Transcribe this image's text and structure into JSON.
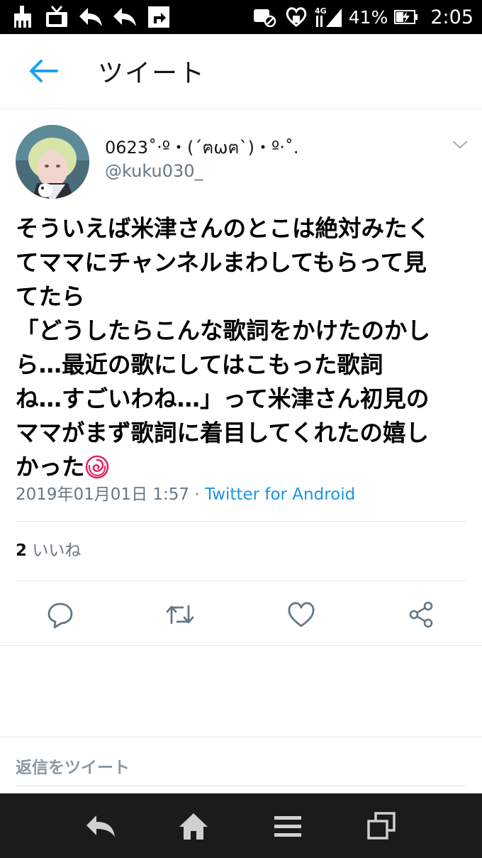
{
  "status_bar": {
    "battery": "41%",
    "time": "2:05",
    "network": "4G",
    "icons": [
      "broom-icon",
      "tv-icon",
      "reply-arrow-icon",
      "reply-arrow-icon",
      "share-box-icon",
      "no-sim-icon",
      "heart-shield-icon",
      "signal-icon",
      "battery-charging-icon"
    ]
  },
  "header": {
    "title": "ツイート",
    "back_icon": "back-arrow-icon",
    "accent_color": "#1da1f2"
  },
  "tweet": {
    "display_name": "0623˚‧º・(´ฅωฅ`)・º‧˚.",
    "screen_name": "@kuku030_",
    "text": "そういえば米津さんのとこは絶対みたく\nてママにチャンネルまわしてもらって見\nてたら\n「どうしたらこんな歌詞をかけたのかし\nら…最近の歌にしてはこもった歌詞\nね…すごいわね…」って米津さん初見の\nママがまず歌詞に着目してくれたの嬉し\nかった",
    "emoji": "rose-icon",
    "timestamp": "2019年01月01日 1:57",
    "separator": "·",
    "source": "Twitter for Android",
    "like_count": "2",
    "like_label": "いいね"
  },
  "actions": {
    "reply": "reply-icon",
    "retweet": "retweet-icon",
    "like": "heart-icon",
    "share": "share-icon"
  },
  "reply_box": {
    "placeholder": "返信をツイート"
  },
  "nav_bar": {
    "icons": [
      "back-icon",
      "home-icon",
      "menu-icon",
      "recent-apps-icon"
    ]
  }
}
